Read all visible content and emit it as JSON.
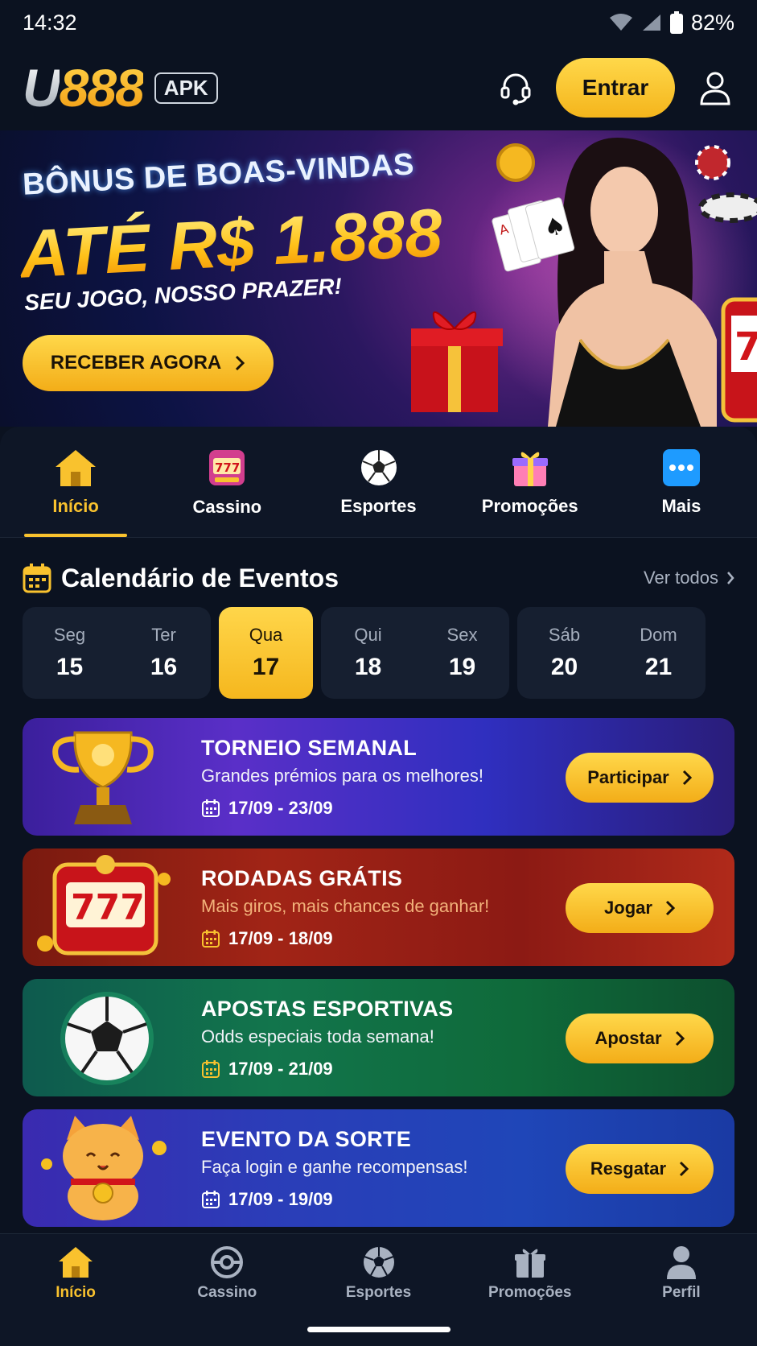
{
  "status": {
    "time": "14:32",
    "battery": "82%"
  },
  "header": {
    "logo_u": "U",
    "logo_888": "888",
    "apk": "APK",
    "login_label": "Entrar"
  },
  "hero": {
    "line1": "BÔNUS DE BOAS-VINDAS",
    "line2": "ATÉ R$ 1.888",
    "line3": "SEU JOGO, NOSSO PRAZER!",
    "cta": "RECEBER AGORA"
  },
  "categories": [
    {
      "label": "Início",
      "icon": "house-icon"
    },
    {
      "label": "Cassino",
      "icon": "slot-machine-icon"
    },
    {
      "label": "Esportes",
      "icon": "soccer-ball-icon"
    },
    {
      "label": "Promoções",
      "icon": "gift-icon"
    },
    {
      "label": "Mais",
      "icon": "more-dots-icon"
    }
  ],
  "calendar": {
    "title": "Calendário de Eventos",
    "see_all": "Ver todos",
    "days": [
      {
        "wd": "Seg",
        "dn": "15"
      },
      {
        "wd": "Ter",
        "dn": "16"
      },
      {
        "wd": "Qua",
        "dn": "17"
      },
      {
        "wd": "Qui",
        "dn": "18"
      },
      {
        "wd": "Sex",
        "dn": "19"
      },
      {
        "wd": "Sáb",
        "dn": "20"
      },
      {
        "wd": "Dom",
        "dn": "21"
      }
    ]
  },
  "events": [
    {
      "name": "TORNEIO SEMANAL",
      "desc": "Grandes prémios para os melhores!",
      "date": "17/09 - 23/09",
      "cta": "Participar"
    },
    {
      "name": "RODADAS GRÁTIS",
      "desc": "Mais giros, mais chances de ganhar!",
      "date": "17/09 - 18/09",
      "cta": "Jogar"
    },
    {
      "name": "APOSTAS ESPORTIVAS",
      "desc": "Odds especiais toda semana!",
      "date": "17/09 - 21/09",
      "cta": "Apostar"
    },
    {
      "name": "EVENTO DA SORTE",
      "desc": "Faça login e ganhe recompensas!",
      "date": "17/09 - 19/09",
      "cta": "Resgatar"
    }
  ],
  "bottom_nav": [
    {
      "label": "Início"
    },
    {
      "label": "Cassino"
    },
    {
      "label": "Esportes"
    },
    {
      "label": "Promoções"
    },
    {
      "label": "Perfil"
    }
  ],
  "colors": {
    "accent": "#f9c22e",
    "background": "#0b1220",
    "panel": "#161f30"
  }
}
